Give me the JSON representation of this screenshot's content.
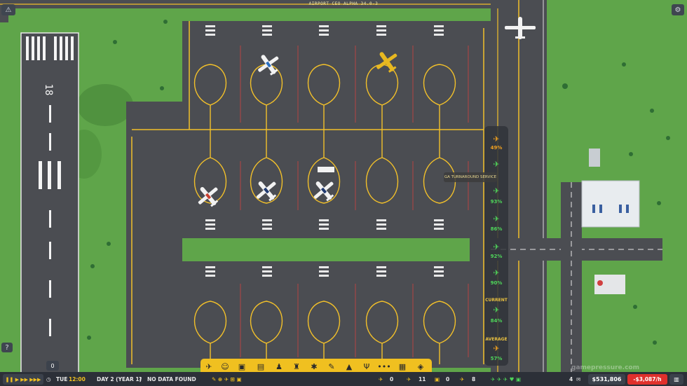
{
  "top_title": "AIRPORT CEO ALPHA 34.0-3",
  "runway_marking": "18",
  "tooltip": "GA TURNAROUND SERVICE",
  "ratings": {
    "values": [
      "49%",
      "93%",
      "86%",
      "92%",
      "90%",
      "84%",
      "57%"
    ],
    "current_label": "CURRENT",
    "average_label": "AVERAGE"
  },
  "bottom": {
    "day": "TUE",
    "time": "12:00",
    "date": "DAY 2 (YEAR 1)",
    "status": "NO DATA FOUND",
    "counter_left": "0",
    "count_a": "0",
    "count_b": "11",
    "count_c": "0",
    "count_d": "8",
    "count_e": "4",
    "cash": "$531,806",
    "income": "-$3,087/h",
    "help": "?",
    "speed_controls": "❚❚ ▶ ▶▶ ▶▶▶"
  },
  "watermark": "gamepressure.com",
  "colors": {
    "grass": "#5fa54a",
    "asphalt": "#4b4d52",
    "taxi_line": "#f2c02a",
    "panel": "#30343a",
    "accent_green": "#4fd65a",
    "accent_orange": "#f0a020",
    "income_red": "#e0302c",
    "buildbar": "#f0c020"
  }
}
